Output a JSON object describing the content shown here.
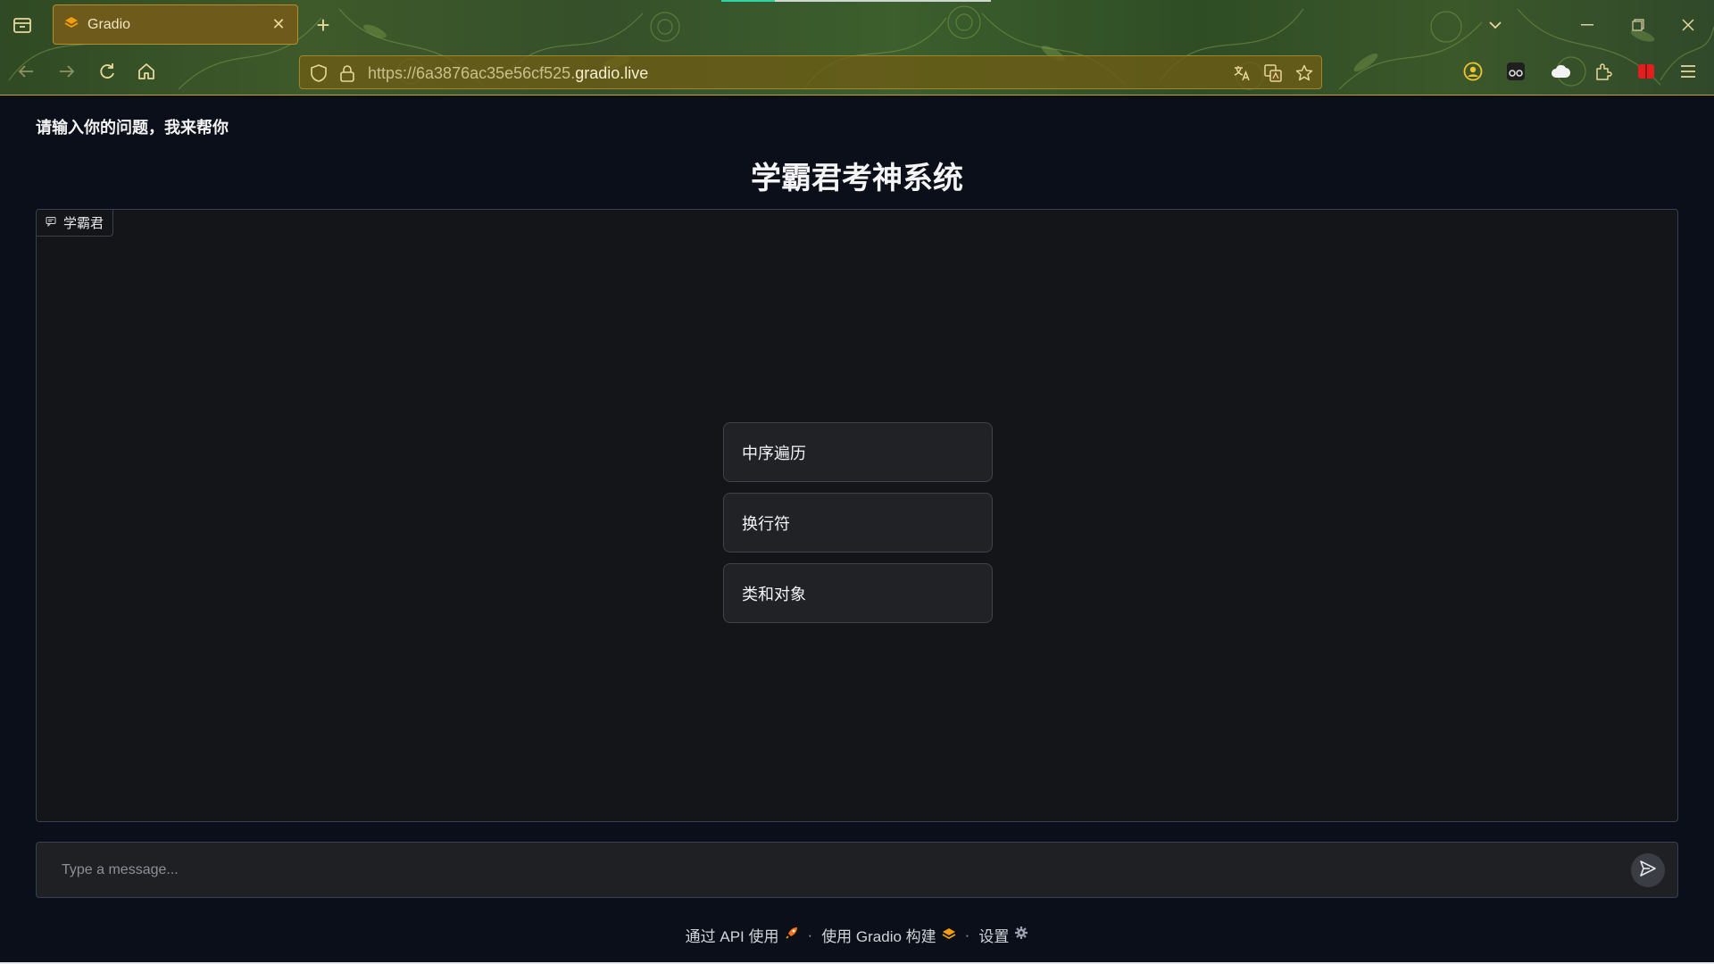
{
  "browser": {
    "tab_title": "Gradio",
    "url_prefix": "https://6a3876ac35e56cf525.",
    "url_domain": "gradio.live",
    "accent": "#c9a227",
    "icons": [
      "tab-list-icon",
      "gradio-logo-icon",
      "close-icon",
      "new-tab-icon",
      "tabs-dropdown-icon",
      "minimize-icon",
      "restore-icon",
      "window-close-icon",
      "back-icon",
      "forward-icon",
      "reload-icon",
      "home-icon",
      "shield-icon",
      "lock-icon",
      "translate-icon",
      "page-translate-icon",
      "bookmark-star-icon",
      "account-icon",
      "extension-reader-icon",
      "extension-cloud-icon",
      "extensions-icon",
      "extension-red-icon",
      "menu-icon"
    ]
  },
  "page": {
    "top_note": "请输入你的问题，我来帮你",
    "title": "学霸君考神系统",
    "chatbot_label": "学霸君",
    "examples": [
      {
        "label": "中序遍历"
      },
      {
        "label": "换行符"
      },
      {
        "label": "类和对象"
      }
    ],
    "input_placeholder": "Type a message...",
    "footer": {
      "api_label": "通过 API 使用",
      "built_label": "使用 Gradio 构建",
      "settings_label": "设置",
      "separator": "·"
    }
  }
}
